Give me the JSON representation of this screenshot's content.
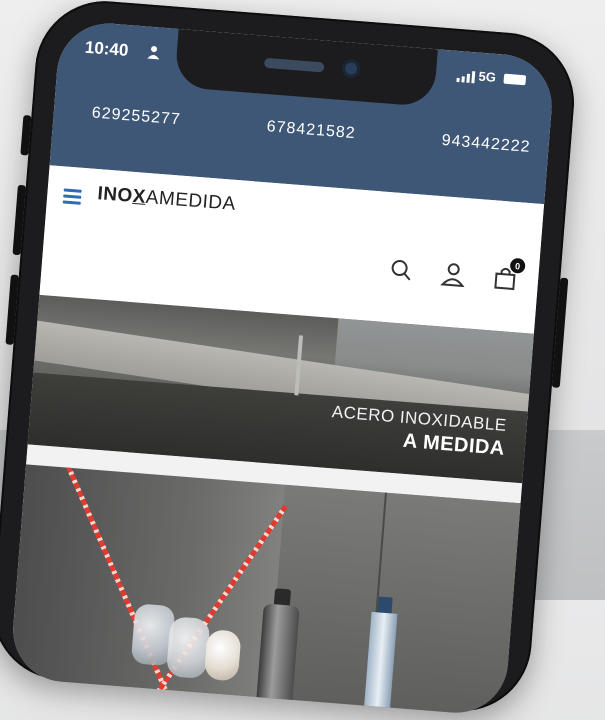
{
  "status_bar": {
    "time": "10:40",
    "network": "5G",
    "person_icon": "person-icon",
    "signal_icon": "signal-icon",
    "battery_icon": "battery-icon"
  },
  "contact_phones": [
    "629255277",
    "678421582",
    "943442222"
  ],
  "header": {
    "logo_part1": "INO",
    "logo_part2": "X",
    "logo_part3": "AMEDIDA",
    "menu_icon": "hamburger-menu-icon",
    "search_icon": "search-icon",
    "account_icon": "user-icon",
    "cart_icon": "shopping-bag-icon",
    "cart_count": "0"
  },
  "hero": {
    "line1": "ACERO INOXIDABLE",
    "line2": "A MEDIDA"
  },
  "colors": {
    "status_bar_bg": "#3e5777",
    "menu_accent": "#2f6cb5",
    "phone_frame": "#1c1c1e"
  }
}
